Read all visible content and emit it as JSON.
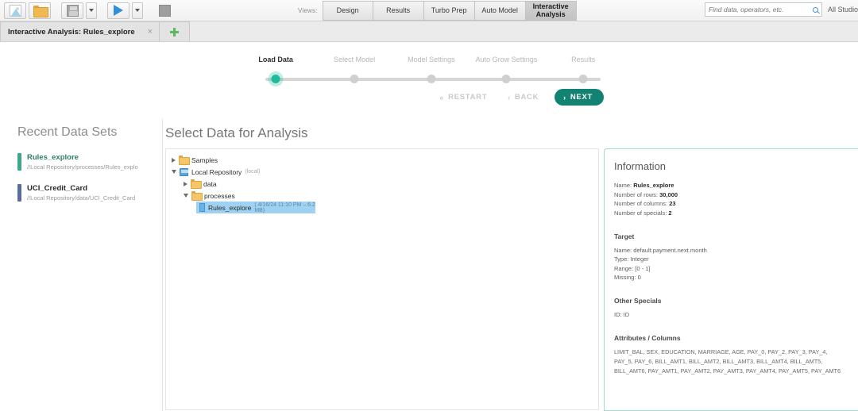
{
  "toolbar": {
    "icons": [
      {
        "name": "new-process-icon",
        "label": "New Process"
      },
      {
        "name": "open-process-icon",
        "label": "Open Process"
      },
      {
        "name": "save-process-icon",
        "label": "Save Process"
      },
      {
        "name": "save-dropdown-icon",
        "label": "Save Options"
      },
      {
        "name": "run-process-icon",
        "label": "Run Process"
      },
      {
        "name": "run-dropdown-icon",
        "label": "Run Options"
      },
      {
        "name": "stop-process-icon",
        "label": "Stop Process"
      }
    ],
    "views_label": "Views:",
    "views": [
      {
        "label": "Design",
        "active": false
      },
      {
        "label": "Results",
        "active": false
      },
      {
        "label": "Turbo Prep",
        "active": false
      },
      {
        "label": "Auto Model",
        "active": false
      },
      {
        "label": "Interactive Analysis",
        "active": true
      }
    ],
    "search": {
      "placeholder": "Find data, operators, etc.",
      "value": "",
      "icon": "search-icon"
    },
    "all_studio_label": "All Studio"
  },
  "tabbar": {
    "tab_title": "Interactive Analysis: Rules_explore",
    "close_glyph": "×",
    "add_tab_icon": "plus-icon"
  },
  "wizard": {
    "steps": [
      {
        "label": "Load Data",
        "active": true
      },
      {
        "label": "Select Model",
        "active": false
      },
      {
        "label": "Model Settings",
        "active": false
      },
      {
        "label": "Auto Grow Settings",
        "active": false
      },
      {
        "label": "Results",
        "active": false
      }
    ],
    "buttons": {
      "restart": "RESTART",
      "restart_glyph": "«",
      "back": "BACK",
      "back_glyph": "‹",
      "next": "NEXT",
      "next_glyph": "›"
    },
    "accent_color": "#1fb99b",
    "next_color": "#128272"
  },
  "recent": {
    "heading": "Recent Data Sets",
    "items": [
      {
        "name": "Rules_explore",
        "path": "//Local Repository/processes/Rules_explo",
        "color": "#3aa88a"
      },
      {
        "name": "UCI_Credit_Card",
        "path": "//Local Repository/data/UCI_Credit_Card",
        "color": "#5a6c9e"
      }
    ]
  },
  "select_data": {
    "heading": "Select Data for Analysis",
    "tree": [
      {
        "label": "Samples",
        "sub": "",
        "icon": "folder-icon",
        "state": "collapsed",
        "indent": 0,
        "selected": false
      },
      {
        "label": "Local Repository",
        "sub": "(local)",
        "icon": "repository-icon",
        "state": "expanded",
        "indent": 0,
        "selected": false
      },
      {
        "label": "data",
        "sub": "",
        "icon": "folder-icon",
        "state": "collapsed",
        "indent": 1,
        "selected": false
      },
      {
        "label": "processes",
        "sub": "",
        "icon": "folder-icon",
        "state": "expanded",
        "indent": 1,
        "selected": false
      },
      {
        "label": "Rules_explore",
        "sub": "( 4/16/24 11:10 PM – 6.2 MB)",
        "icon": "data-file-icon",
        "state": "leaf",
        "indent": 2,
        "selected": true
      }
    ]
  },
  "information": {
    "heading": "Information",
    "name_label": "Name:",
    "name_value": "Rules_explore",
    "rows_label": "Number of rows:",
    "rows_value": "30,000",
    "columns_label": "Number of columns:",
    "columns_value": "23",
    "specials_label": "Number of specials:",
    "specials_value": "2",
    "target_heading": "Target",
    "target_name_label": "Name:",
    "target_name_value": "default.payment.next.month",
    "target_type_label": "Type:",
    "target_type_value": "Integer",
    "target_range_label": "Range:",
    "target_range_value": "[0 -  1]",
    "target_missing_label": "Missing:",
    "target_missing_value": "0",
    "other_specials_heading": "Other Specials",
    "other_specials_value": "ID: ID",
    "attributes_heading": "Attributes / Columns",
    "attributes_value": "LIMIT_BAL, SEX, EDUCATION, MARRIAGE, AGE, PAY_0, PAY_2, PAY_3, PAY_4, PAY_5, PAY_6, BILL_AMT1, BILL_AMT2, BILL_AMT3, BILL_AMT4, BILL_AMT5, BILL_AMT6, PAY_AMT1, PAY_AMT2, PAY_AMT3, PAY_AMT4, PAY_AMT5, PAY_AMT6"
  }
}
